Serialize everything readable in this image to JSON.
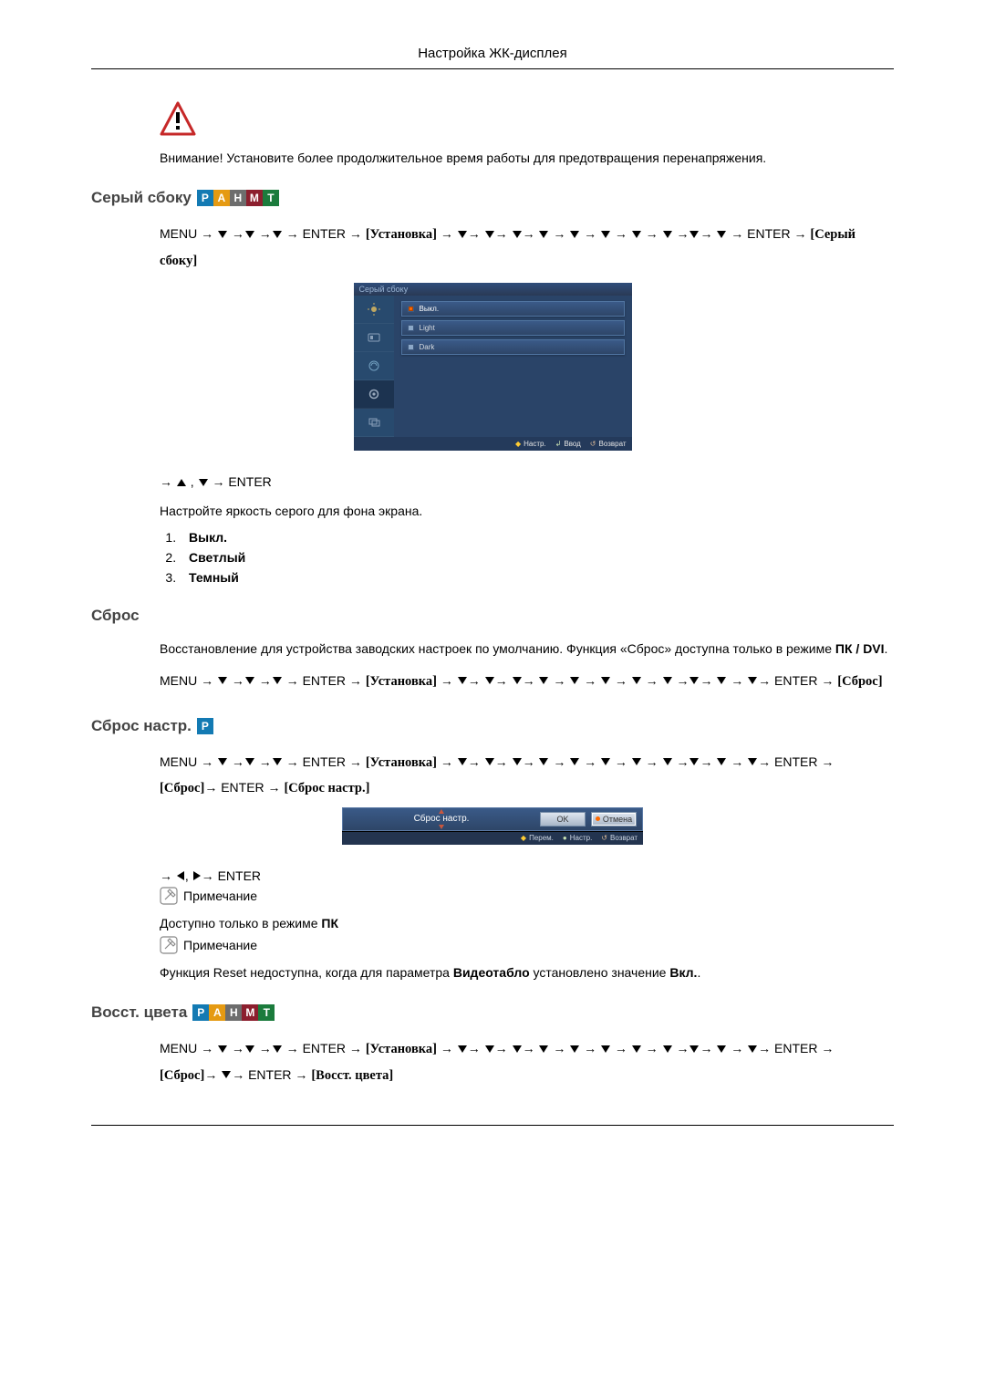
{
  "page_header": "Настройка ЖК-дисплея",
  "warning_text": "Внимание! Установите более продолжительное время работы для предотвращения перенапряжения.",
  "mode_letters": {
    "p": "P",
    "a": "A",
    "h": "H",
    "m": "M",
    "t": "T"
  },
  "kw": {
    "menu": "MENU",
    "enter": "ENTER",
    "ustanovka": "[Установка]",
    "sery": "[Серый сбоку]",
    "sbros": "[Сброс]",
    "sbros_nastr": "[Сброс настр.]",
    "vosst": "[Восст. цвета]"
  },
  "gray_side": {
    "heading": "Серый сбоку",
    "post_nav": "→ ▲ , ▼ → ENTER",
    "desc": "Настройте яркость серого для фона экрана.",
    "options": [
      "Выкл.",
      "Светлый",
      "Темный"
    ]
  },
  "osd1": {
    "title": "Серый сбоку",
    "rows": [
      "Выкл.",
      "Light",
      "Dark"
    ],
    "footer": {
      "move": "Настр.",
      "enter": "Ввод",
      "return": "Возврат"
    }
  },
  "reset": {
    "heading": "Сброс",
    "desc1": "Восстановление для устройства заводских настроек по умолчанию. Функция «Сброс» доступна только в режиме ",
    "desc1_bold": "ПК / DVI",
    "desc1_tail": "."
  },
  "reset_img": {
    "heading": "Сброс настр."
  },
  "osd2": {
    "title": "Сброс настр.",
    "ok": "OK",
    "cancel": "Отмена",
    "footer": {
      "move": "Перем.",
      "enter": "Настр.",
      "return": "Возврат"
    }
  },
  "post_osd2_nav": "→ ◄, ►→ ENTER",
  "note_label": "Примечание",
  "pc_only_text_pre": "Доступно только в режиме ",
  "pc_only_text_bold": "ПК",
  "reset_unavail_pre": "Функция Reset недоступна, когда для параметра ",
  "reset_unavail_param": "Видеотабло",
  "reset_unavail_mid": " установлено значение ",
  "reset_unavail_val": "Вкл.",
  "reset_unavail_tail": ".",
  "color_reset_heading": "Восст. цвета"
}
